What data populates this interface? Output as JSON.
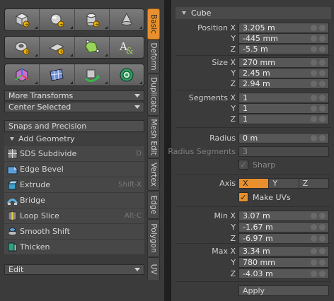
{
  "toolbox": {
    "tool_rows": [
      [
        "cube-tool",
        "sphere-tool",
        "cylinder-tool",
        "cone-tool"
      ],
      [
        "torus-tool",
        "plane-tool",
        "pen-tool",
        "text-tool"
      ],
      [
        "axis-tool",
        "mesh-tool",
        "bend-tool",
        "gear-tool"
      ]
    ],
    "more_transforms": "More Transforms",
    "center_selected": "Center Selected",
    "snaps": "Snaps and Precision",
    "add_geometry": "Add Geometry",
    "tools": [
      {
        "label": "SDS Subdivide",
        "shortcut": "D"
      },
      {
        "label": "Edge Bevel",
        "shortcut": ""
      },
      {
        "label": "Extrude",
        "shortcut": "Shift-X"
      },
      {
        "label": "Bridge",
        "shortcut": ""
      },
      {
        "label": "Loop Slice",
        "shortcut": "Alt-C"
      },
      {
        "label": "Smooth Shift",
        "shortcut": ""
      },
      {
        "label": "Thicken",
        "shortcut": ""
      }
    ],
    "edit": "Edit",
    "tabs": [
      "Basic",
      "Deform",
      "Duplicate",
      "Mesh Edit",
      "Vertex",
      "Edge",
      "Polygon",
      "UV"
    ]
  },
  "properties": {
    "title": "Cube",
    "position_label": "Position X",
    "size_label": "Size X",
    "segments_label": "Segments X",
    "y": "Y",
    "z": "Z",
    "position": {
      "x": "3.205 m",
      "y": "-445 mm",
      "z": "-5.5 m"
    },
    "size": {
      "x": "270 mm",
      "y": "2.45 m",
      "z": "2.94 m"
    },
    "segments": {
      "x": "1",
      "y": "1",
      "z": "1"
    },
    "radius_label": "Radius",
    "radius": "0 m",
    "radius_segments_label": "Radius Segments",
    "radius_segments": "3",
    "sharp": "Sharp",
    "axis_label": "Axis",
    "axis_options": [
      "X",
      "Y",
      "Z"
    ],
    "make_uvs": "Make UVs",
    "min_label": "Min X",
    "min": {
      "x": "3.07 m",
      "y": "-1.67 m",
      "z": "-6.97 m"
    },
    "max_label": "Max X",
    "max": {
      "x": "3.34 m",
      "y": "780 mm",
      "z": "-4.03 m"
    },
    "apply": "Apply"
  },
  "colors": {
    "accent": "#e8902d",
    "panel": "#3b3b3b",
    "field": "#575757"
  }
}
